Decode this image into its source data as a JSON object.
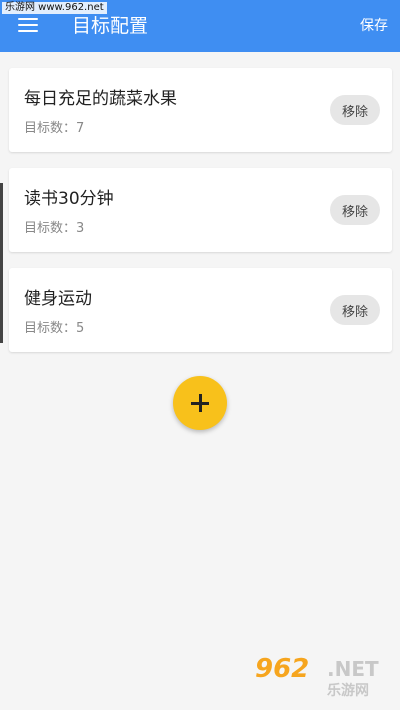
{
  "watermark": {
    "top_left": "乐游网 www.962.net",
    "logo": "962",
    "net": ".NET",
    "sub": "乐游网"
  },
  "appbar": {
    "menu_icon": "menu-icon",
    "title": "目标配置",
    "save_label": "保存",
    "color": "#3f8ef2"
  },
  "goals": [
    {
      "title": "每日充足的蔬菜水果",
      "count_label": "目标数：7",
      "remove_label": "移除"
    },
    {
      "title": "读书30分钟",
      "count_label": "目标数：3",
      "remove_label": "移除"
    },
    {
      "title": "健身运动",
      "count_label": "目标数：5",
      "remove_label": "移除"
    }
  ],
  "fab": {
    "icon": "plus-icon",
    "color": "#f8c11b"
  }
}
